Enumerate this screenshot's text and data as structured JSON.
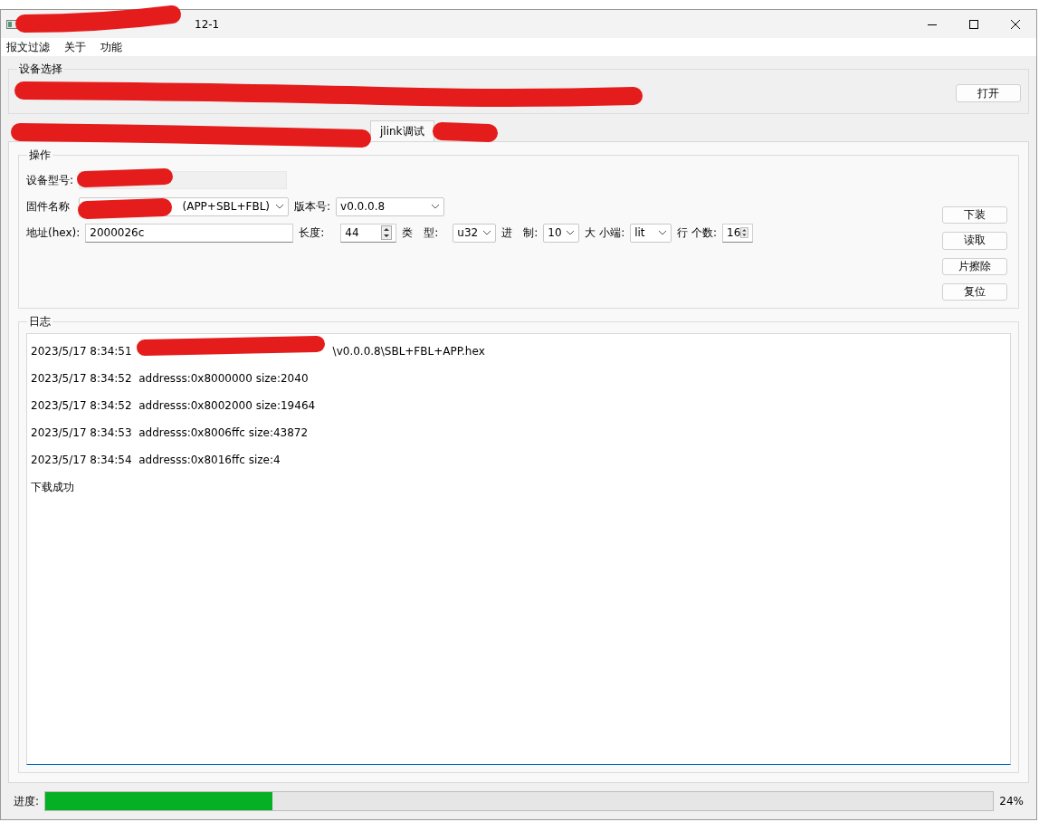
{
  "window": {
    "title": "12-1"
  },
  "menu": [
    {
      "label": "报文过滤"
    },
    {
      "label": "关于"
    },
    {
      "label": "功能"
    }
  ],
  "device_group": {
    "title": "设备选择",
    "open_button": "打开"
  },
  "tabs": [
    {
      "label": "jlink调试",
      "selected": true
    }
  ],
  "operation": {
    "title": "操作",
    "device_model_label": "设备型号:",
    "firmware": {
      "label": "固件名称",
      "value": "(APP+SBL+FBL)"
    },
    "version": {
      "label": "版本号:",
      "value": "v0.0.0.8"
    },
    "address": {
      "label": "地址(hex):",
      "value": "2000026c"
    },
    "length": {
      "label": "长度:",
      "value": "44"
    },
    "type": {
      "label": "类　型:",
      "value": "u32"
    },
    "radix": {
      "label": "进　制:",
      "value": "10"
    },
    "endian": {
      "label": "大 小端:",
      "value": "lit"
    },
    "count": {
      "label": "行 个数:",
      "value": "16"
    },
    "buttons": [
      "下装",
      "读取",
      "片擦除",
      "复位"
    ]
  },
  "log": {
    "title": "日志",
    "lines": [
      {
        "text": "2023/5/17 8:34:51",
        "tail": "\\v0.0.0.8\\SBL+FBL+APP.hex"
      },
      {
        "text": "2023/5/17 8:34:52  addresss:0x8000000 size:2040"
      },
      {
        "text": "2023/5/17 8:34:52  addresss:0x8002000 size:19464"
      },
      {
        "text": "2023/5/17 8:34:53  addresss:0x8006ffc size:43872"
      },
      {
        "text": "2023/5/17 8:34:54  addresss:0x8016ffc size:4"
      },
      {
        "text": "下载成功"
      }
    ]
  },
  "progress": {
    "label": "进度:",
    "level": 0.24,
    "reading": "24%"
  }
}
